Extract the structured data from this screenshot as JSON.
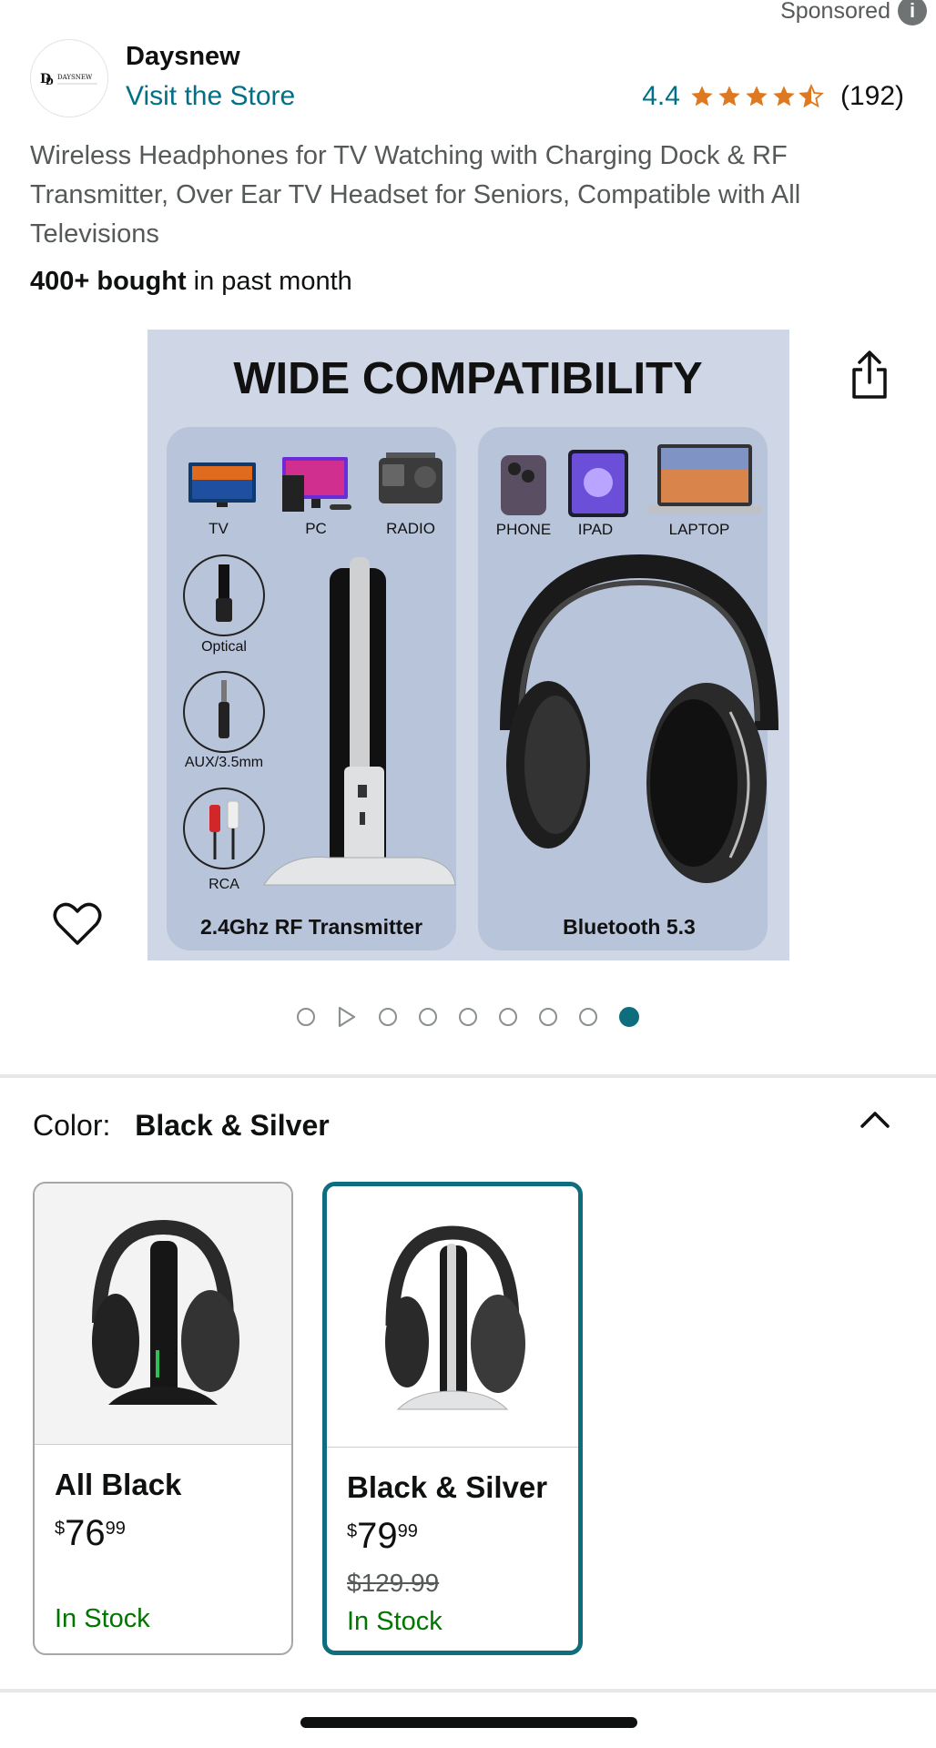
{
  "header": {
    "sponsored_label": "Sponsored",
    "info_icon": "info-icon"
  },
  "brand": {
    "logo_text": "DAYSNEW",
    "name": "Daysnew",
    "visit_store": "Visit the Store",
    "rating_value": "4.4",
    "rating_stars": 4.4,
    "rating_count": "(192)"
  },
  "product": {
    "title": "Wireless Headphones for TV Watching with Charging Dock & RF Transmitter, Over Ear TV Headset for Seniors, Compatible with All Televisions",
    "bought_bold": "400+ bought",
    "bought_rest": "in past month"
  },
  "image": {
    "headline": "WIDE COMPATIBILITY",
    "left_devices": [
      "TV",
      "PC",
      "RADIO"
    ],
    "right_devices": [
      "PHONE",
      "IPAD",
      "LAPTOP"
    ],
    "ports": [
      "Optical",
      "AUX/3.5mm",
      "RCA"
    ],
    "left_caption": "2.4Ghz RF Transmitter",
    "right_caption": "Bluetooth 5.3",
    "bg_color": "#cfd6e5",
    "panel_color": "#b8c4da",
    "carousel_count": 9,
    "carousel_active": 9
  },
  "color_selector": {
    "label": "Color:",
    "value": "Black & Silver"
  },
  "variants": [
    {
      "name": "All Black",
      "price_symbol": "$",
      "price_dollars": "76",
      "price_cents": "99",
      "was_price": "",
      "stock": "In Stock"
    },
    {
      "name": "Black & Silver",
      "price_symbol": "$",
      "price_dollars": "79",
      "price_cents": "99",
      "was_price": "$129.99",
      "stock": "In Stock"
    }
  ],
  "colors": {
    "link": "#007185",
    "star": "#de7921",
    "selected_border": "#0f6e7d",
    "in_stock": "#007600"
  }
}
